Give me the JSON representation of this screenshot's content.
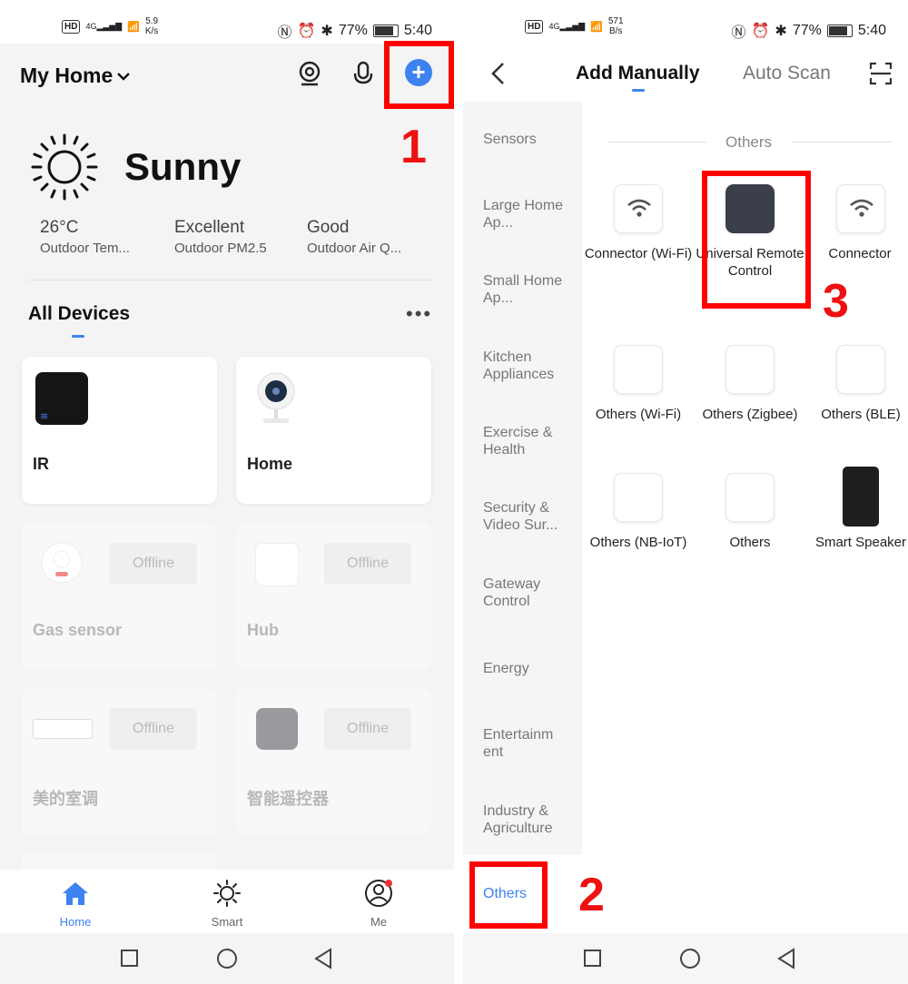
{
  "left": {
    "status": {
      "hd": "HD",
      "net": "4G",
      "speed": "5.9",
      "speed_unit": "K/s",
      "battery": "77%",
      "time": "5:40"
    },
    "header": {
      "title": "My Home",
      "chevron": "⌄"
    },
    "annotations": {
      "step1": "1",
      "step2": "2",
      "step3": "3"
    },
    "weather": {
      "condition": "Sunny",
      "metrics": [
        {
          "value": "26°C",
          "label": "Outdoor Tem..."
        },
        {
          "value": "Excellent",
          "label": "Outdoor PM2.5"
        },
        {
          "value": "Good",
          "label": "Outdoor Air Q..."
        }
      ]
    },
    "devices_title": "All Devices",
    "more": "•••",
    "devices": [
      {
        "name": "IR",
        "status": ""
      },
      {
        "name": "Home",
        "status": ""
      },
      {
        "name": "Gas sensor",
        "status": "Offline"
      },
      {
        "name": "Hub",
        "status": "Offline"
      },
      {
        "name": "美的室调",
        "status": "Offline"
      },
      {
        "name": "智能遥控器",
        "status": "Offline"
      }
    ],
    "tabbar": [
      {
        "label": "Home"
      },
      {
        "label": "Smart"
      },
      {
        "label": "Me"
      }
    ],
    "colors": {
      "accent": "#3d82f1",
      "annotation": "#ff0000"
    }
  },
  "right": {
    "status": {
      "hd": "HD",
      "net": "4G",
      "speed": "571",
      "speed_unit": "B/s",
      "battery": "77%",
      "time": "5:40"
    },
    "header": {
      "tab_active": "Add Manually",
      "tab_inactive": "Auto Scan"
    },
    "categories": [
      "Sensors",
      "Large Home Ap...",
      "Small Home Ap...",
      "Kitchen Appliances",
      "Exercise & Health",
      "Security & Video Sur...",
      "Gateway Control",
      "Energy",
      "Entertainm ent",
      "Industry & Agriculture"
    ],
    "selected_category": "Others",
    "section_title": "Others",
    "devices": [
      {
        "label": "Connector (Wi-Fi)",
        "icon": "wifi-icon"
      },
      {
        "label": "Universal Remote Control",
        "icon": "remote-icon"
      },
      {
        "label": "Connector",
        "icon": "wifi-icon"
      },
      {
        "label": "Others (Wi-Fi)",
        "icon": "blank-tile"
      },
      {
        "label": "Others (Zigbee)",
        "icon": "blank-tile"
      },
      {
        "label": "Others (BLE)",
        "icon": "blank-tile"
      },
      {
        "label": "Others (NB-IoT)",
        "icon": "blank-tile"
      },
      {
        "label": "Others",
        "icon": "blank-tile"
      },
      {
        "label": "Smart Speaker",
        "icon": "speaker-icon"
      }
    ]
  }
}
